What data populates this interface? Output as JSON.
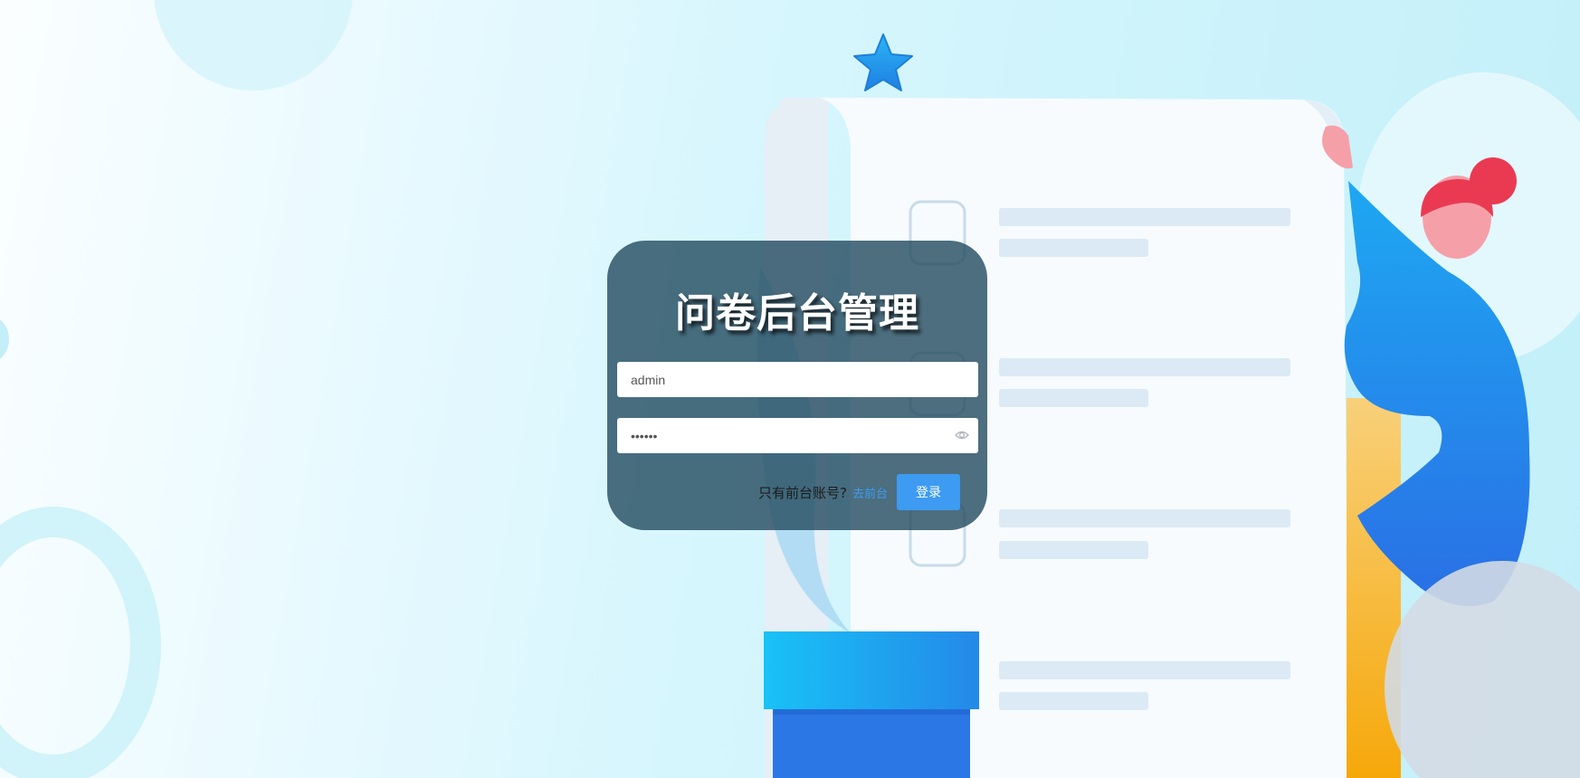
{
  "login": {
    "title": "问卷后台管理",
    "username_value": "admin",
    "password_value": "••••••",
    "hint": "只有前台账号?",
    "front_link": "去前台",
    "login_button": "登录"
  },
  "icons": {
    "password_toggle": "eye-icon",
    "decoration": "star-icon"
  },
  "colors": {
    "card": "#264e62",
    "button": "#3d9bf2",
    "link": "#3b9cf5"
  }
}
